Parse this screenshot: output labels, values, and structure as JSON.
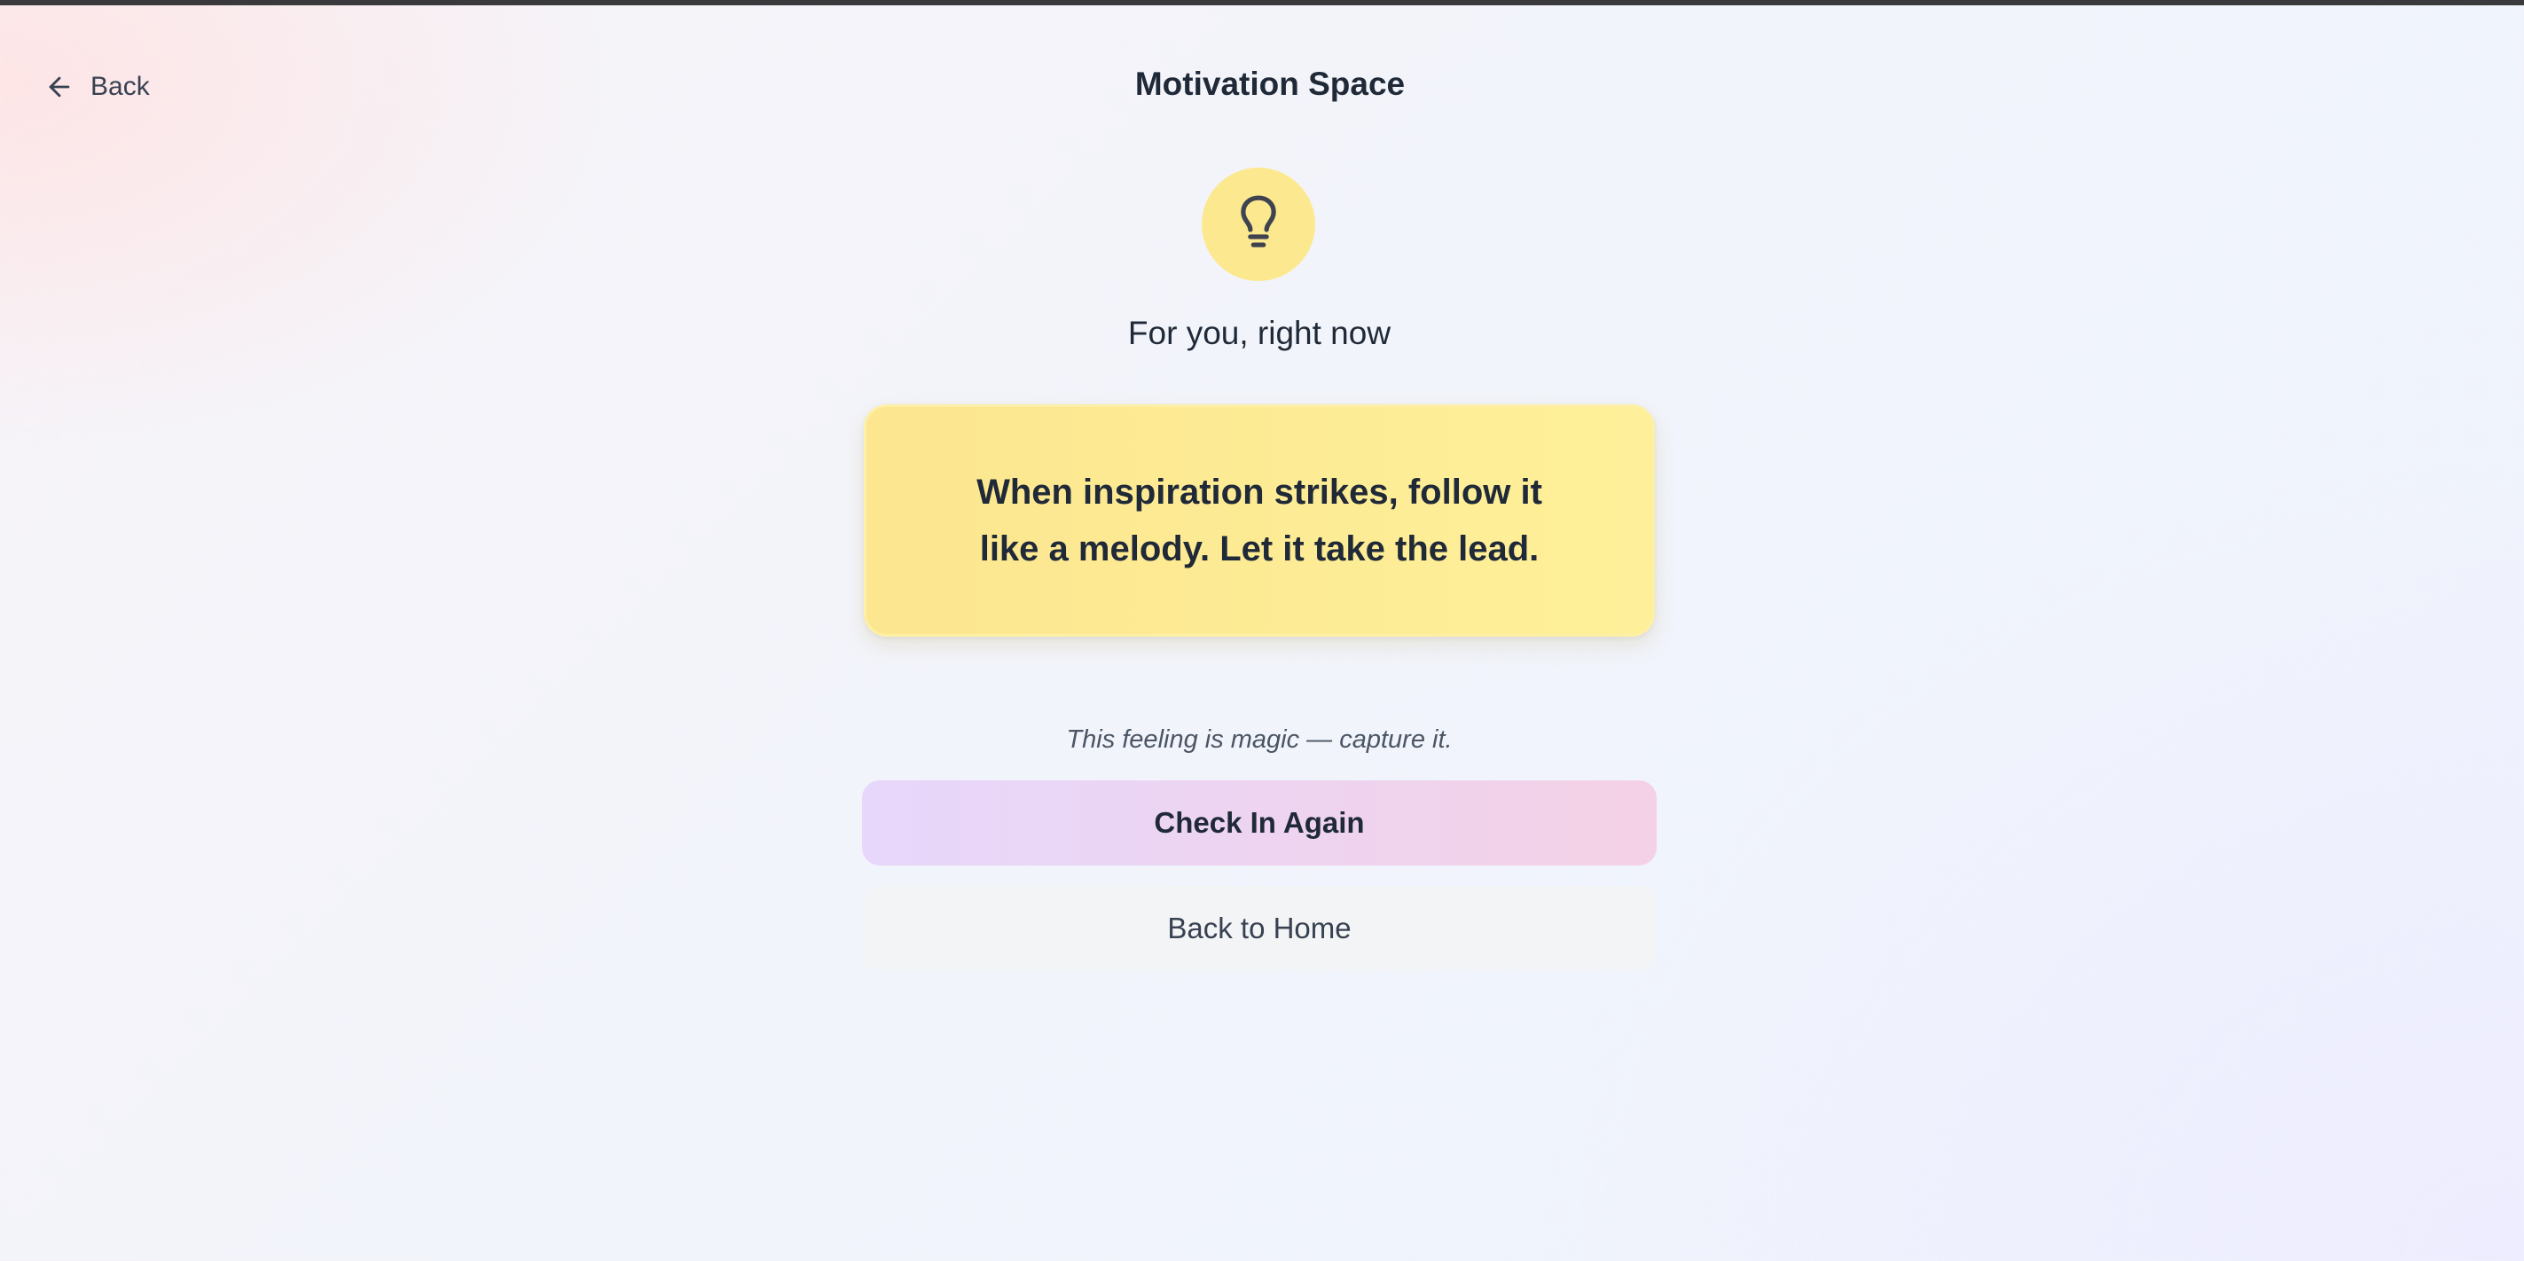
{
  "header": {
    "back_label": "Back",
    "title": "Motivation Space"
  },
  "icons": {
    "back": "arrow-left-icon",
    "badge": "lightbulb-icon"
  },
  "main": {
    "subtitle": "For you, right now",
    "quote": "When inspiration strikes, follow it like a melody. Let it take the lead.",
    "encouragement": "This feeling is magic — capture it.",
    "primary_button": "Check In Again",
    "secondary_button": "Back to Home"
  },
  "colors": {
    "badge_background": "#fce98f",
    "quote_card_background": "#fde98f",
    "primary_button_gradient_start": "#e7d7fb",
    "primary_button_gradient_end": "#f4d1e6",
    "secondary_button_background": "#f3f4f6",
    "text_primary": "#1f2937"
  }
}
